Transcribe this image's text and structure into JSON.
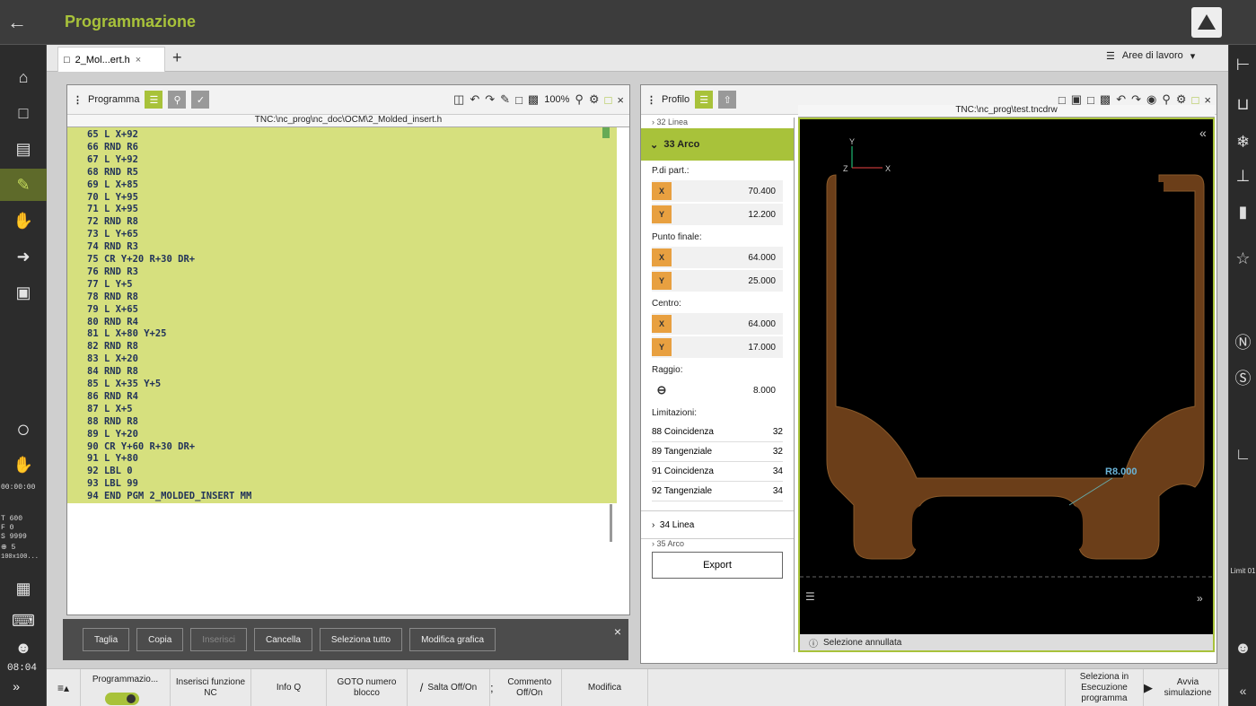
{
  "app": {
    "title": "Programmazione",
    "back_icon": "back-arrow-icon",
    "logo": "heidenhain-logo"
  },
  "tabs": {
    "file_tab": "2_Mol...ert.h",
    "workareas": "Aree di lavoro"
  },
  "left_sidebar": {
    "items": [
      "home-icon",
      "folder-icon",
      "table-icon",
      "program-edit-icon",
      "hand-icon",
      "run-icon",
      "machine-icon"
    ],
    "lower_items": [
      "circle-icon",
      "hand-icon-2"
    ],
    "time": "00:00:00",
    "readouts": [
      "T  600",
      "F     0",
      "S 9999",
      "⊕  5",
      "100x100..."
    ],
    "clock": "08:04",
    "more": "»"
  },
  "right_sidebar": {
    "items": [
      "tool-icon",
      "plug-icon",
      "snowflake-icon",
      "axis-icon",
      "spindle-icon",
      "star-icon",
      "feed-override-icon",
      "spindle-override-icon",
      "clamp-icon"
    ],
    "limit_text": "Limit\n01"
  },
  "program_panel": {
    "title": "Programma",
    "zoom": "100%",
    "path": "TNC:\\nc_prog\\nc_doc\\OCM\\2_Molded_insert.h",
    "lines": [
      "65 L X+92",
      "66 RND R6",
      "67 L Y+92",
      "68 RND R5",
      "69 L X+85",
      "70 L Y+95",
      "71 L X+95",
      "72 RND R8",
      "73 L Y+65",
      "74 RND R3",
      "75 CR Y+20 R+30 DR+",
      "76 RND R3",
      "77 L Y+5",
      "78 RND R8",
      "79 L X+65",
      "80 RND R4",
      "81 L X+80 Y+25",
      "82 RND R8",
      "83 L X+20",
      "84 RND R8",
      "85 L X+35 Y+5",
      "86 RND R4",
      "87 L X+5",
      "88 RND R8",
      "89 L Y+20",
      "90 CR Y+60 R+30 DR+",
      "91 L Y+80",
      "92 LBL 0",
      "93 LBL 99",
      "94 END PGM 2_MOLDED_INSERT MM"
    ],
    "buttons": [
      "Taglia",
      "Copia",
      "Inserisci",
      "Cancella",
      "Seleziona tutto",
      "Modifica grafica"
    ]
  },
  "profile_panel": {
    "title": "Profilo",
    "path": "TNC:\\nc_prog\\test.tncdrw",
    "prev_item": "32 Linea",
    "selected_item": "33 Arco",
    "start_label": "P.di part.:",
    "start": {
      "x": "70.400",
      "y": "12.200"
    },
    "end_label": "Punto finale:",
    "end": {
      "x": "64.000",
      "y": "25.000"
    },
    "center_label": "Centro:",
    "center": {
      "x": "64.000",
      "y": "17.000"
    },
    "radius_label": "Raggio:",
    "radius": "8.000",
    "limits_label": "Limitazioni:",
    "limits": [
      {
        "name": "88 Coincidenza",
        "val": "32"
      },
      {
        "name": "89 Tangenziale",
        "val": "32"
      },
      {
        "name": "91 Coincidenza",
        "val": "34"
      },
      {
        "name": "92 Tangenziale",
        "val": "34"
      }
    ],
    "next_item": "34 Linea",
    "next_item2": "35 Arco",
    "export": "Export",
    "radius_label_canvas": "R8.000",
    "status": "Selezione annullata"
  },
  "bottom_bar": {
    "programmazione": "Programmazio...",
    "inserisci": "Inserisci funzione NC",
    "infoq": "Info Q",
    "goto": "GOTO numero blocco",
    "salta": "Salta Off/On",
    "commento": "Commento Off/On",
    "modifica": "Modifica",
    "seleziona": "Seleziona in Esecuzione programma",
    "avvia": "Avvia simulazione"
  }
}
